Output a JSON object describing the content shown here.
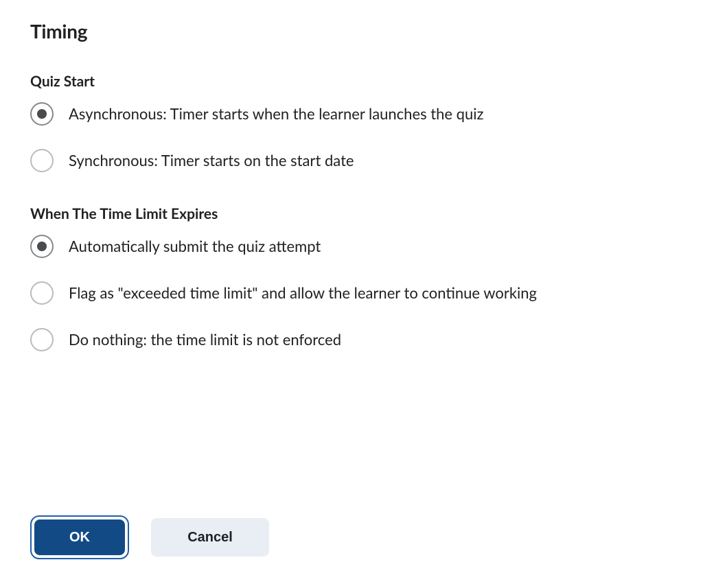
{
  "title": "Timing",
  "sections": {
    "quizStart": {
      "label": "Quiz Start",
      "options": [
        {
          "id": "asynchronous",
          "label": "Asynchronous: Timer starts when the learner launches the quiz",
          "selected": true
        },
        {
          "id": "synchronous",
          "label": "Synchronous: Timer starts on the start date",
          "selected": false
        }
      ]
    },
    "timeLimit": {
      "label": "When The Time Limit Expires",
      "options": [
        {
          "id": "auto-submit",
          "label": "Automatically submit the quiz attempt",
          "selected": true
        },
        {
          "id": "flag-exceeded",
          "label": "Flag as \"exceeded time limit\" and allow the learner to continue working",
          "selected": false
        },
        {
          "id": "do-nothing",
          "label": "Do nothing: the time limit is not enforced",
          "selected": false
        }
      ]
    }
  },
  "buttons": {
    "ok": "OK",
    "cancel": "Cancel"
  }
}
